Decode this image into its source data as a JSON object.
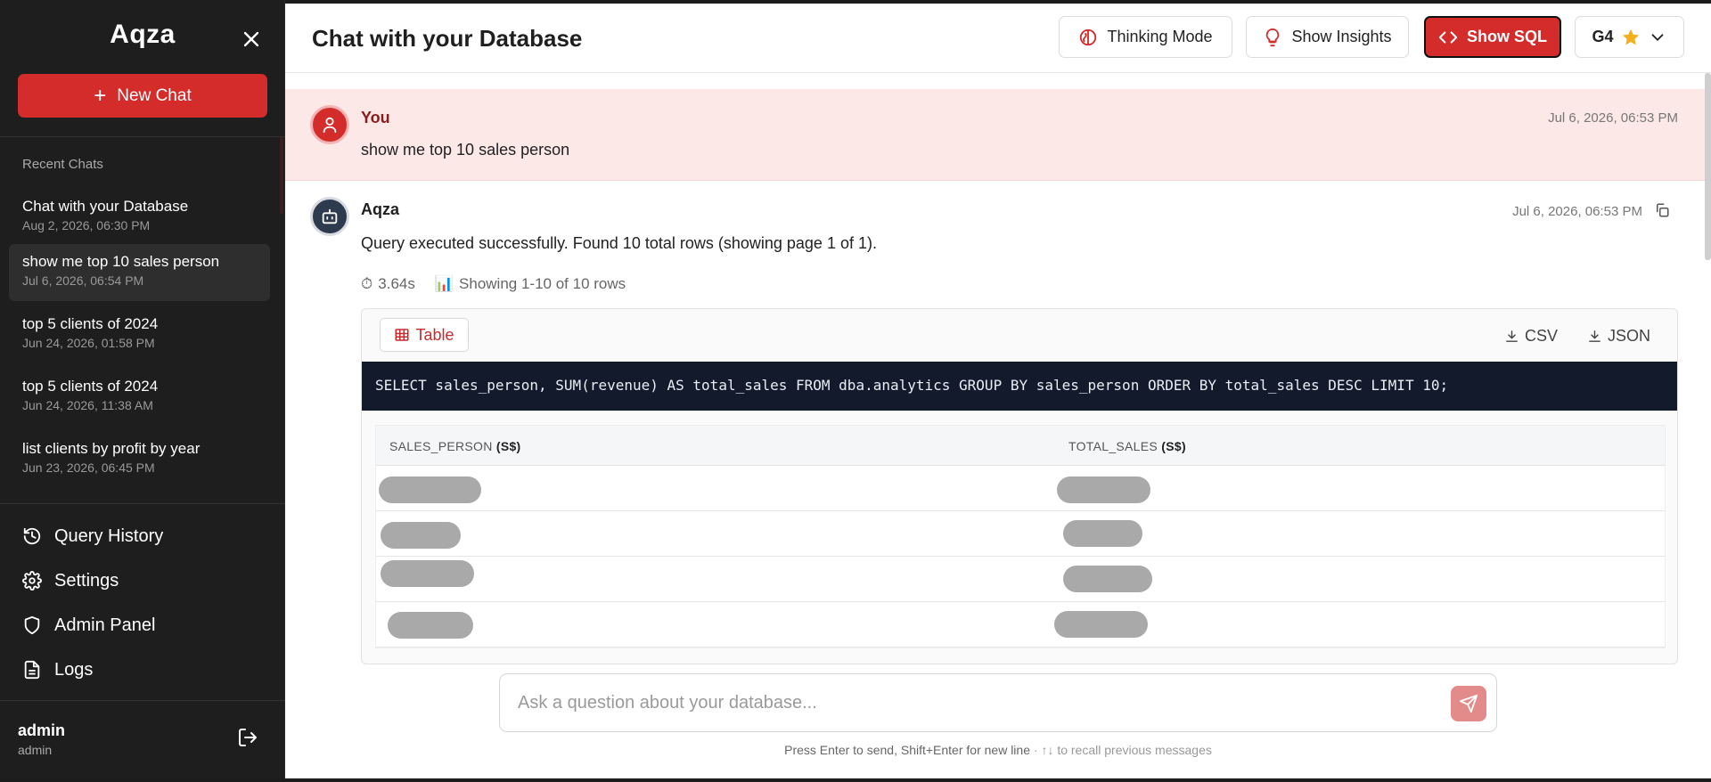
{
  "sidebar": {
    "brand": "Aqza",
    "new_chat_label": "New Chat",
    "recent_title": "Recent Chats",
    "recent_chats": [
      {
        "title": "Chat with your Database",
        "date": "Aug 2, 2026, 06:30 PM"
      },
      {
        "title": "show me top 10 sales person",
        "date": "Jul 6, 2026, 06:54 PM"
      },
      {
        "title": "top 5 clients of 2024",
        "date": "Jun 24, 2026, 01:58 PM"
      },
      {
        "title": "top 5 clients of 2024",
        "date": "Jun 24, 2026, 11:38 AM"
      },
      {
        "title": "list clients by profit by year",
        "date": "Jun 23, 2026, 06:45 PM"
      }
    ],
    "nav": [
      {
        "label": "Query History",
        "icon": "history-icon"
      },
      {
        "label": "Settings",
        "icon": "gear-icon"
      },
      {
        "label": "Admin Panel",
        "icon": "shield-icon"
      },
      {
        "label": "Logs",
        "icon": "document-icon"
      }
    ],
    "user": {
      "name": "admin",
      "role": "admin"
    }
  },
  "header": {
    "title": "Chat with your Database",
    "thinking_mode": "Thinking Mode",
    "show_insights": "Show Insights",
    "show_sql": "Show SQL",
    "model": "G4"
  },
  "messages": {
    "user": {
      "author": "You",
      "text": "show me top 10 sales person",
      "time": "Jul 6, 2026, 06:53 PM"
    },
    "bot": {
      "author": "Aqza",
      "text": "Query executed successfully. Found 10 total rows (showing page 1 of 1).",
      "time": "Jul 6, 2026, 06:53 PM",
      "duration": "3.64s",
      "rows_info": "Showing 1-10 of 10 rows",
      "tab_label": "Table",
      "csv_label": "CSV",
      "json_label": "JSON",
      "sql": "SELECT sales_person, SUM(revenue) AS total_sales FROM dba.analytics GROUP BY sales_person ORDER BY total_sales DESC LIMIT 10;",
      "columns": [
        {
          "name": "SALES_PERSON",
          "unit": "(S$)"
        },
        {
          "name": "TOTAL_SALES",
          "unit": "(S$)"
        }
      ]
    }
  },
  "input": {
    "placeholder": "Ask a question about your database...",
    "hint_main": "Press Enter to send, Shift+Enter for new line",
    "hint_sub": " · ↑↓ to recall previous messages"
  },
  "colors": {
    "accent": "#d42b2b",
    "sidebar_bg": "#1e1e1e",
    "user_msg_bg": "#fde8e8",
    "sql_bg": "#121a2b"
  }
}
